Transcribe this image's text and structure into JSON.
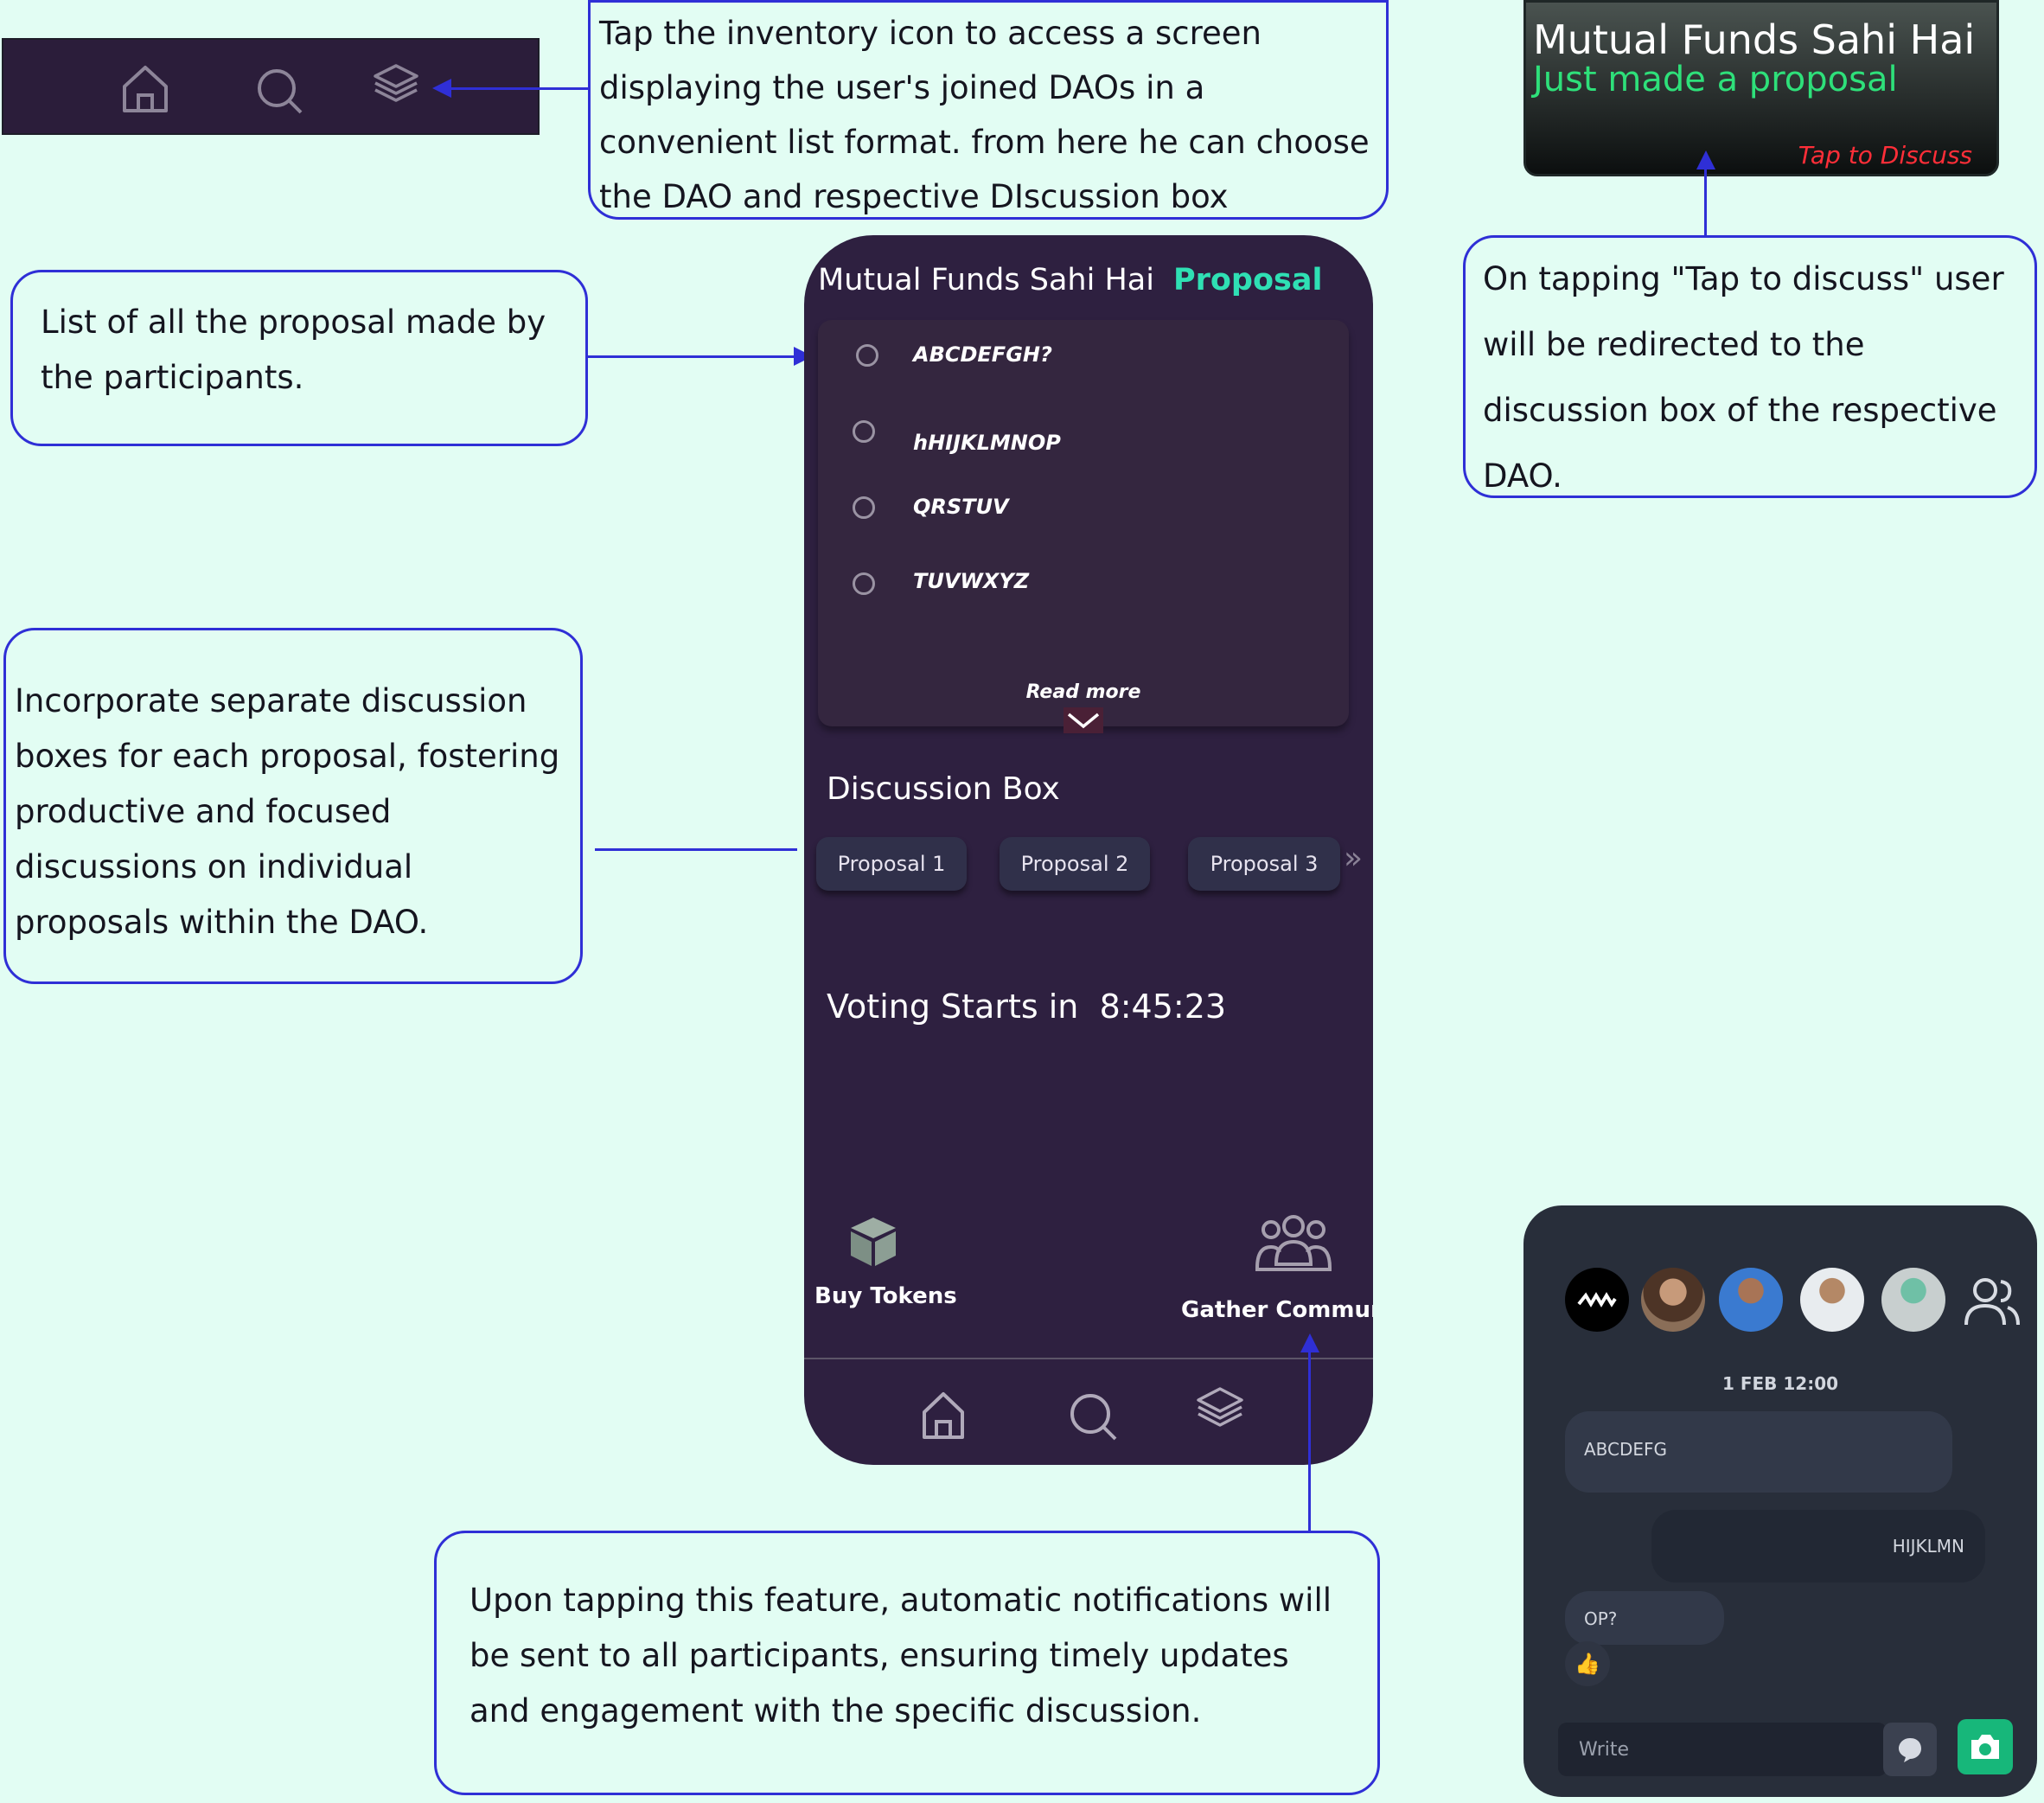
{
  "colors": {
    "canvas": "#e2fdf3",
    "annotation_blue": "#2f2fd6",
    "phone_bg": "#2e2040",
    "accent_teal": "#2fe0b4",
    "notification_green": "#2ee07a",
    "notification_red": "#ff2e38",
    "chat_bg": "#282e3a",
    "send_green": "#17b77a"
  },
  "annotations": {
    "inventory": "Tap the inventory icon to access a screen displaying the user's joined DAOs in a convenient list format. from here he can choose the DAO and respective DIscussion box",
    "proposal_list": "List of all the proposal made by the participants.",
    "tap_to_discuss": "On tapping \"Tap to discuss\" user will be redirected to the discussion box of the respective DAO.",
    "discussion_boxes": "Incorporate separate discussion boxes for each proposal, fostering productive and focused discussions on individual proposals within the DAO.",
    "gather_community": "Upon tapping this feature, automatic notifications will be sent to all participants, ensuring timely updates and engagement with the specific discussion."
  },
  "nav_icons": [
    "home-icon",
    "search-icon",
    "layers-icon"
  ],
  "phone": {
    "dao_name": "Mutual Funds Sahi Hai",
    "section_label": "Proposal",
    "proposals": [
      "ABCDEFGH?",
      "hHIJKLMNOP",
      "QRSTUV",
      "TUVWXYZ"
    ],
    "read_more": "Read more",
    "discussion_title": "Discussion Box",
    "discussion_tabs": [
      "Proposal 1",
      "Proposal 2",
      "Proposal 3"
    ],
    "more_icon": "double-chevron-right-icon",
    "voting_label": "Voting Starts in",
    "voting_timer": "8:45:23",
    "buy_tokens": "Buy Tokens",
    "gather_community": "Gather Community"
  },
  "notification": {
    "title": "Mutual Funds Sahi Hai",
    "subtitle": "Just made a proposal",
    "cta": "Tap to Discuss"
  },
  "chat": {
    "date": "1 FEB 12:00",
    "messages": [
      {
        "text": "ABCDEFG",
        "side": "left"
      },
      {
        "text": "HIJKLMN",
        "side": "right"
      },
      {
        "text": "OP?",
        "side": "left"
      }
    ],
    "reaction": "👍",
    "input_placeholder": "Write"
  }
}
